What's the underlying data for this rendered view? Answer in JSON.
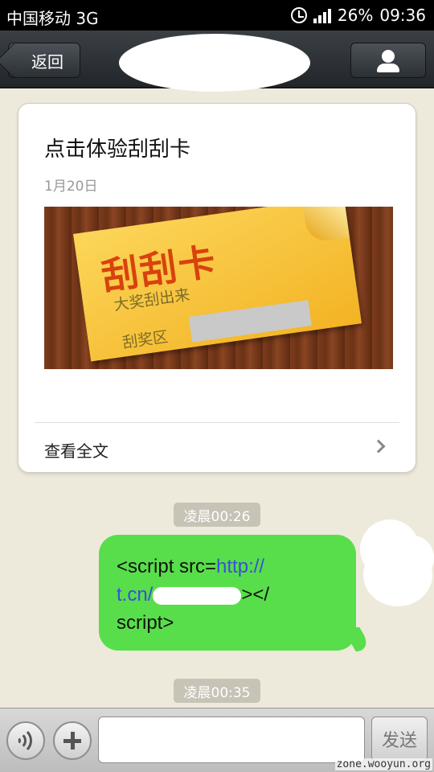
{
  "status_bar": {
    "carrier": "中国移动 3G",
    "battery": "26%",
    "time": "09:36",
    "icons": [
      "alarm-icon",
      "signal-icon"
    ]
  },
  "nav": {
    "back_label": "返回",
    "icons": [
      "back-arrow-icon",
      "person-icon"
    ]
  },
  "article": {
    "title": "点击体验刮刮卡",
    "date": "1月20日",
    "image": {
      "title": "刮刮卡",
      "subtitle": "大奖刮出来",
      "area_label": "刮奖区"
    },
    "read_more": "查看全文"
  },
  "messages": {
    "timestamp_1": "凌晨00:26",
    "bubble": {
      "prefix": "<script src=",
      "link_part1": "http://",
      "link_part2": "t.cn/",
      "suffix_1": "></",
      "suffix_2": "script>"
    },
    "timestamp_2": "凌晨00:35"
  },
  "input_bar": {
    "placeholder": "",
    "send_label": "发送"
  },
  "watermark": "zone.wooyun.org",
  "colors": {
    "background": "#eeeadb",
    "bubble_green": "#58de4a",
    "link_blue": "#3a4fd8",
    "nav_dark": "#2b3035"
  }
}
